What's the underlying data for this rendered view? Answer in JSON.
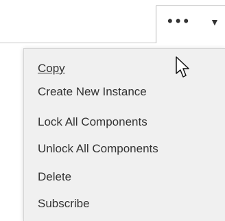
{
  "toolbar": {
    "more_icon": "more-options-icon",
    "dropdown_icon": "chevron-down-icon"
  },
  "menu": {
    "items": [
      {
        "label": "Copy",
        "style": "underlined"
      },
      {
        "label": "Create New Instance"
      },
      {
        "label": "Lock All Components"
      },
      {
        "label": "Unlock All Components"
      },
      {
        "label": "Delete"
      },
      {
        "label": "Subscribe"
      }
    ]
  },
  "background": {
    "partial_text": "S"
  },
  "cursor": {
    "icon": "mouse-cursor-icon"
  }
}
